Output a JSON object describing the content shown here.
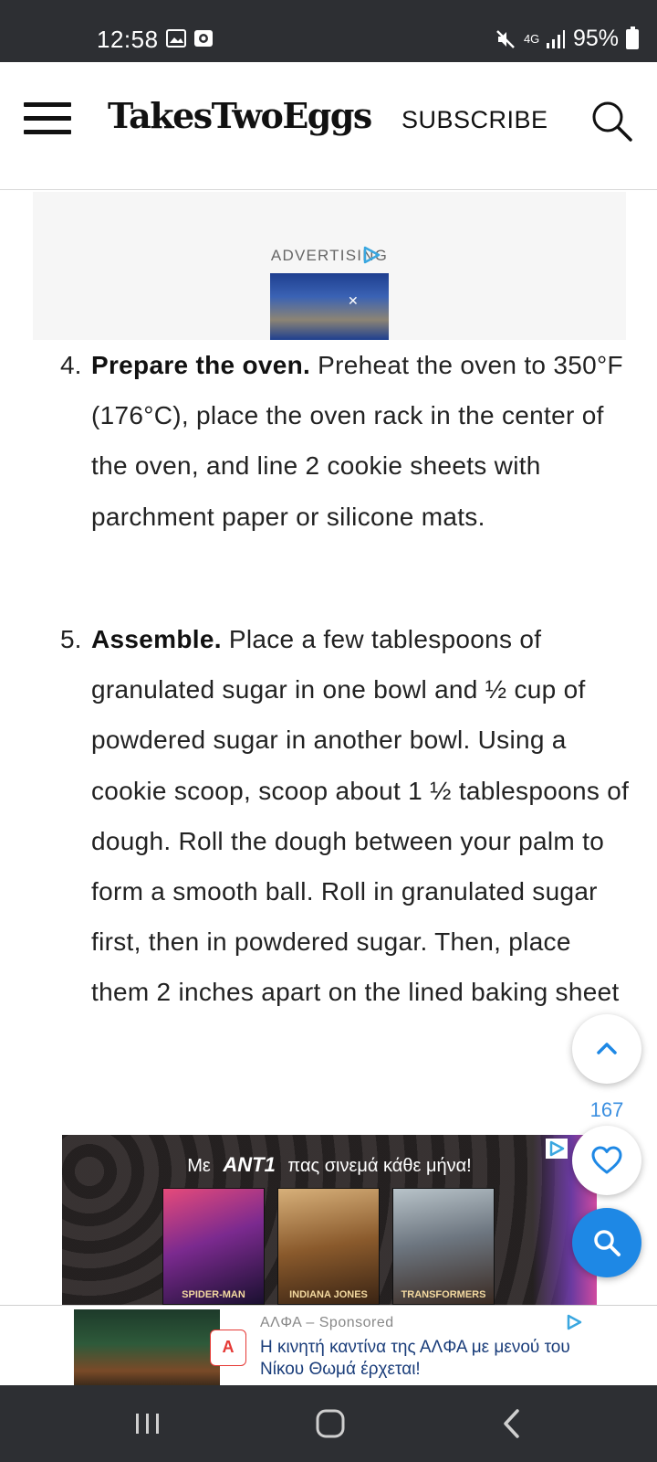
{
  "status_bar": {
    "time": "12:58",
    "battery_percent": "95%",
    "network": "4G"
  },
  "header": {
    "logo": "TakesTwoEggs",
    "subscribe_label": "SUBSCRIBE"
  },
  "ad_top": {
    "label": "ADVERTISING"
  },
  "steps": [
    {
      "number": "4.",
      "title": "Prepare the oven.",
      "text": " Preheat the oven to 350°F (176°C), place the oven rack in the center of the oven, and line 2 cookie sheets with parchment paper or silicone mats."
    },
    {
      "number": "5.",
      "title": "Assemble.",
      "text": " Place a few tablespoons of granulated sugar in one bowl and ½ cup of powdered sugar in another bowl. Using a cookie scoop, scoop about 1 ½ tablespoons of dough. Roll the dough between your palm to form a smooth ball. Roll in granulated sugar first, then in powdered sugar. Then, place them 2 inches apart on the lined baking sheet"
    }
  ],
  "floating": {
    "heart_count": "167"
  },
  "ad_movie": {
    "headline_pre": "Με",
    "brand": "ANT1",
    "headline_post": "πας σινεμά κάθε μήνα!",
    "posters": [
      "SPIDER-MAN",
      "INDIANA JONES",
      "TRANSFORMERS"
    ]
  },
  "sponsored": {
    "brand": "ΑΛΦΑ",
    "sponsored_label": "Sponsored",
    "text": "Η κινητή καντίνα της ΑΛΦΑ με μενού του Νίκου Θωμά έρχεται!",
    "logo_letter": "A"
  },
  "colors": {
    "status_bar": "#2d2f33",
    "accent_blue": "#1e88e5",
    "heart_count": "#3b8fe0"
  }
}
